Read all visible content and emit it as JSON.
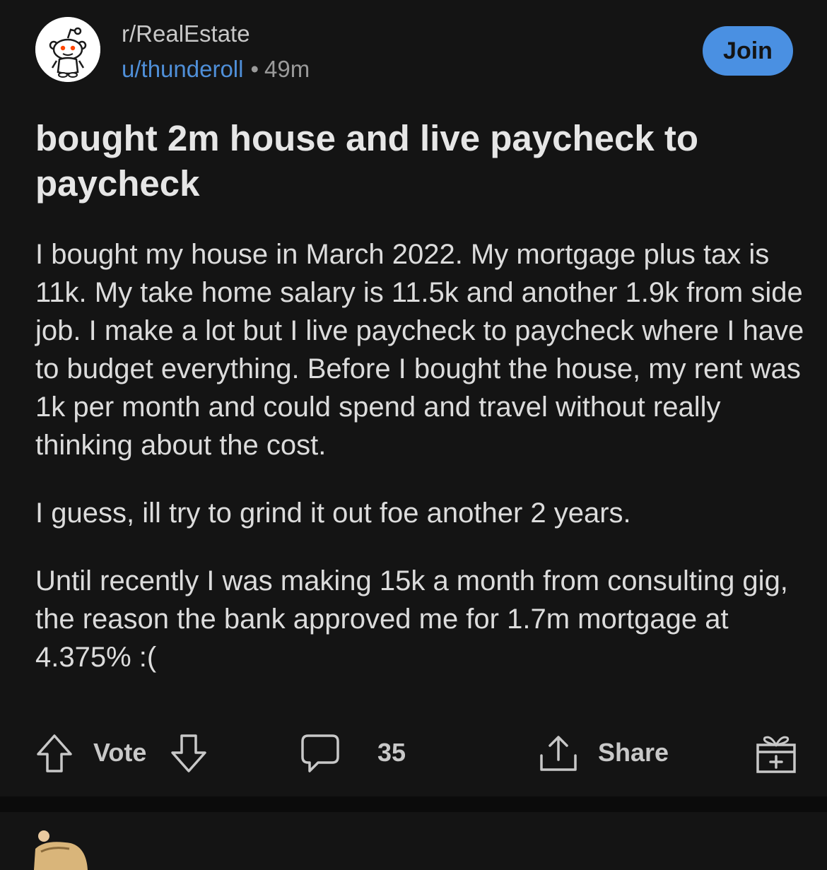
{
  "post": {
    "subreddit": "r/RealEstate",
    "username": "u/thunderoll",
    "separator": "•",
    "time": "49m",
    "join_label": "Join",
    "title": "bought 2m house and live paycheck to paycheck",
    "paragraphs": [
      "I bought my house in March 2022. My mortgage plus tax is 11k. My take home salary is 11.5k and another 1.9k from side job. I make a lot but I live paycheck to paycheck where I have to budget everything. Before I bought the house, my rent was 1k per month and could spend and travel without really thinking about the cost.",
      "I guess, ill try to grind it out foe another 2 years.",
      "Until recently I was making 15k a month from consulting gig, the reason the bank approved me for 1.7m mortgage at 4.375% :("
    ]
  },
  "actions": {
    "vote_label": "Vote",
    "comments_count": "35",
    "share_label": "Share"
  },
  "icons": {
    "upvote": "arrow-up-icon",
    "downvote": "arrow-down-icon",
    "comment": "comment-bubble-icon",
    "share": "share-icon",
    "award": "gift-icon",
    "avatar": "snoo-avatar-icon"
  },
  "colors": {
    "background": "#141414",
    "username": "#4f8fd8",
    "join_button": "#4a90e2"
  }
}
